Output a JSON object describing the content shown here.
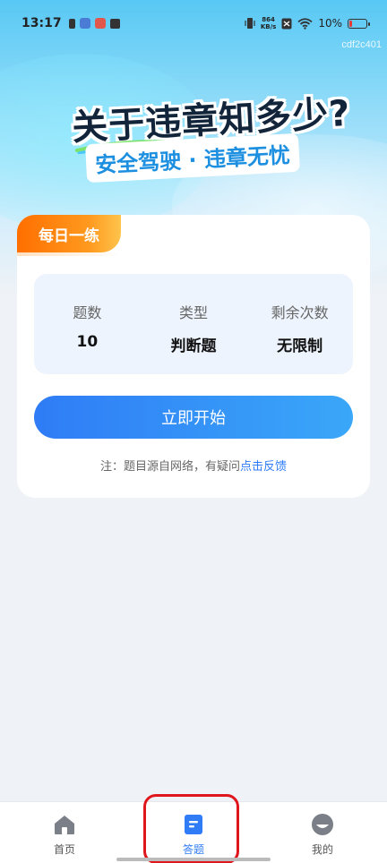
{
  "status_bar": {
    "time": "13:17",
    "net_speed_value": "864",
    "net_speed_unit": "KB/s",
    "battery_text": "10%"
  },
  "watermark": "cdf2c401",
  "hero": {
    "title": "关于违章知多少?",
    "subtitle": "安全驾驶 · 违章无忧"
  },
  "practice_card": {
    "badge": "每日一练",
    "stats": [
      {
        "label": "题数",
        "value": "10"
      },
      {
        "label": "类型",
        "value": "判断题"
      },
      {
        "label": "剩余次数",
        "value": "无限制"
      }
    ],
    "start_button": "立即开始",
    "note_prefix": "注：题目源自网络，有疑问",
    "note_link": "点击反馈"
  },
  "tabbar": {
    "tabs": [
      {
        "label": "首页",
        "icon": "home-icon",
        "active": false
      },
      {
        "label": "答题",
        "icon": "quiz-icon",
        "active": true
      },
      {
        "label": "我的",
        "icon": "profile-icon",
        "active": false
      }
    ]
  },
  "colors": {
    "accent": "#2f7cf6",
    "badge_orange": "#ff7a00",
    "highlight_red": "#e0161d"
  }
}
